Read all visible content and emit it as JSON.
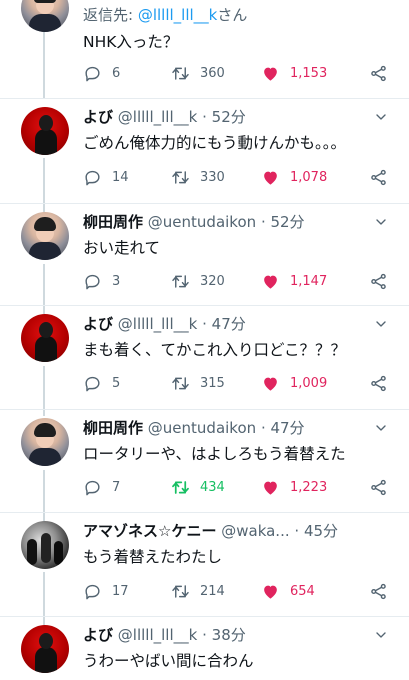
{
  "tweets": [
    {
      "avatar": "avatar-boy-photo",
      "reply_prefix": "返信先: ",
      "reply_mention": "@lllll_lll__k",
      "reply_suffix": "さん",
      "text": "NHK入った？",
      "replies": "6",
      "retweets": "360",
      "likes": "1,153"
    },
    {
      "avatar": "avatar-red-figure",
      "name": "よび",
      "handle": "@lllll_lll__k",
      "time": "· 52分",
      "text": "ごめん俺体力的にもう動けんかも。。。",
      "replies": "14",
      "retweets": "330",
      "likes": "1,078"
    },
    {
      "avatar": "avatar-boy-photo",
      "name": "柳田周作",
      "handle": "@uentudaikon",
      "time": "· 52分",
      "text": "おい走れて",
      "replies": "3",
      "retweets": "320",
      "likes": "1,147"
    },
    {
      "avatar": "avatar-red-figure",
      "name": "よび",
      "handle": "@lllll_lll__k",
      "time": "· 47分",
      "text": "まも着く、てかこれ入り口どこ？？？",
      "replies": "5",
      "retweets": "315",
      "likes": "1,009"
    },
    {
      "avatar": "avatar-boy-photo",
      "name": "柳田周作",
      "handle": "@uentudaikon",
      "time": "· 47分",
      "text": "ロータリーや、はよしろもう着替えた",
      "replies": "7",
      "retweets": "434",
      "likes": "1,223",
      "retweeted": true
    },
    {
      "avatar": "avatar-band-photo",
      "name": "アマゾネス☆ケニー",
      "handle": "@waka...",
      "time": "· 45分",
      "text": "もう着替えたわたし",
      "replies": "17",
      "retweets": "214",
      "likes": "654"
    },
    {
      "avatar": "avatar-red-figure",
      "name": "よび",
      "handle": "@lllll_lll__k",
      "time": "· 38分",
      "text": "うわーやばい間に合わん"
    }
  ],
  "icons": {
    "reply": "reply-icon",
    "retweet": "retweet-icon",
    "like": "heart-icon",
    "share": "share-icon",
    "caret": "chevron-down-icon"
  },
  "colors": {
    "like": "#e0245e",
    "retweet_active": "#17bf63",
    "mention": "#1d9bf0",
    "secondary": "#536471",
    "thread_line": "#cfd9de"
  }
}
